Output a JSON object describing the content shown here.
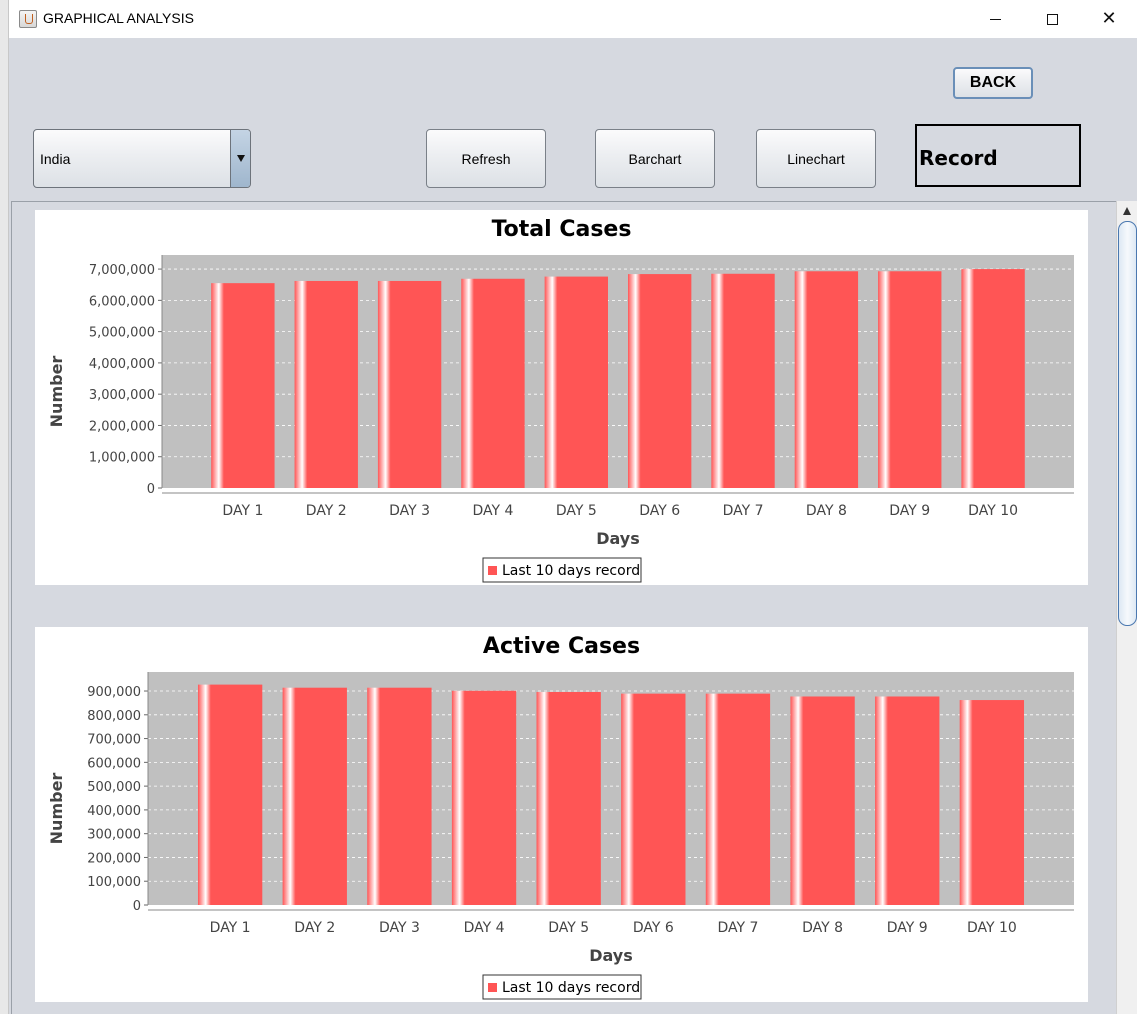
{
  "window": {
    "title": "GRAPHICAL ANALYSIS",
    "controls": [
      "minimize",
      "maximize",
      "close"
    ],
    "close_glyph": "✕"
  },
  "toolbar": {
    "back_label": "BACK",
    "country_selected": "India",
    "refresh_label": "Refresh",
    "barchart_label": "Barchart",
    "linechart_label": "Linechart",
    "record_label": "Record"
  },
  "colors": {
    "bar": "#ff5555",
    "plot_background": "#c0c0c0",
    "window_background": "#d6d9e0"
  },
  "chart_data": [
    {
      "type": "bar",
      "title": "Total Cases",
      "xlabel": "Days",
      "ylabel": "Number",
      "categories": [
        "DAY 1",
        "DAY 2",
        "DAY 3",
        "DAY 4",
        "DAY 5",
        "DAY 6",
        "DAY 7",
        "DAY 8",
        "DAY 9",
        "DAY 10"
      ],
      "series": [
        {
          "name": "Last 10 days record",
          "values": [
            6550000,
            6620000,
            6620000,
            6690000,
            6760000,
            6840000,
            6850000,
            6930000,
            6930000,
            7000000
          ]
        }
      ],
      "ylim": [
        0,
        7450000
      ],
      "yticks": [
        0,
        1000000,
        2000000,
        3000000,
        4000000,
        5000000,
        6000000,
        7000000
      ],
      "ytick_labels": [
        "0",
        "1,000,000",
        "2,000,000",
        "3,000,000",
        "4,000,000",
        "5,000,000",
        "6,000,000",
        "7,000,000"
      ],
      "legend": {
        "position": "bottom",
        "label": "Last 10 days record"
      },
      "grid": true
    },
    {
      "type": "bar",
      "title": "Active Cases",
      "xlabel": "Days",
      "ylabel": "Number",
      "categories": [
        "DAY 1",
        "DAY 2",
        "DAY 3",
        "DAY 4",
        "DAY 5",
        "DAY 6",
        "DAY 7",
        "DAY 8",
        "DAY 9",
        "DAY 10"
      ],
      "series": [
        {
          "name": "Last 10 days record",
          "values": [
            927000,
            914000,
            914000,
            901000,
            896000,
            889000,
            889000,
            877000,
            877000,
            862000
          ]
        }
      ],
      "ylim": [
        0,
        980000
      ],
      "yticks": [
        0,
        100000,
        200000,
        300000,
        400000,
        500000,
        600000,
        700000,
        800000,
        900000
      ],
      "ytick_labels": [
        "0",
        "100,000",
        "200,000",
        "300,000",
        "400,000",
        "500,000",
        "600,000",
        "700,000",
        "800,000",
        "900,000"
      ],
      "legend": {
        "position": "bottom",
        "label": "Last 10 days record"
      },
      "grid": true
    }
  ]
}
